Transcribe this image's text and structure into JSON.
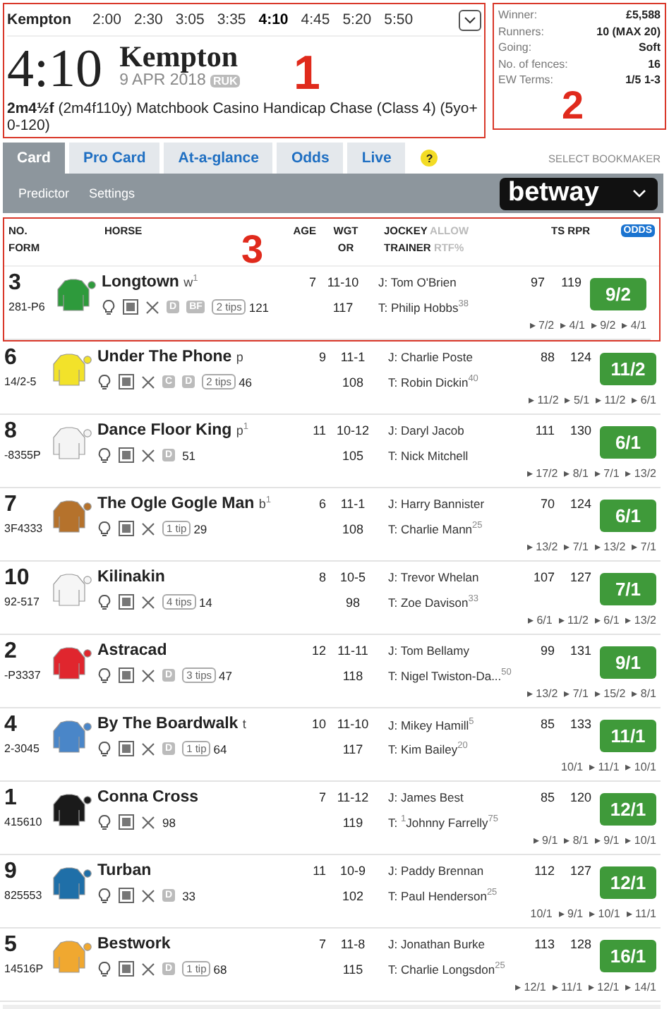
{
  "race_nav": {
    "course": "Kempton",
    "times": [
      {
        "label": "2:00",
        "selected": false
      },
      {
        "label": "2:30",
        "selected": false
      },
      {
        "label": "3:05",
        "selected": false
      },
      {
        "label": "3:35",
        "selected": false
      },
      {
        "label": "4:10",
        "selected": true
      },
      {
        "label": "4:45",
        "selected": false
      },
      {
        "label": "5:20",
        "selected": false
      },
      {
        "label": "5:50",
        "selected": false
      }
    ]
  },
  "race": {
    "time": "4:10",
    "course": "Kempton",
    "date": "9 APR 2018",
    "channel": "RUK",
    "description": "**2m4½f** (2m4f110y) Matchbook Casino Handicap Chase (Class 4) (5yo+ 0-120)",
    "callout": "1"
  },
  "race_info": {
    "rows": [
      {
        "label": "Winner:",
        "value": "£5,588"
      },
      {
        "label": "Runners:",
        "value": "10 (MAX 20)"
      },
      {
        "label": "Going:",
        "value": "Soft"
      },
      {
        "label": "No. of fences:",
        "value": "16"
      },
      {
        "label": "EW Terms:",
        "value": "1/5 1-3"
      }
    ],
    "callout": "2"
  },
  "tabs": [
    {
      "label": "Card",
      "selected": true
    },
    {
      "label": "Pro Card",
      "selected": false
    },
    {
      "label": "At-a-glance",
      "selected": false
    },
    {
      "label": "Odds",
      "selected": false
    },
    {
      "label": "Live",
      "selected": false
    }
  ],
  "help": "?",
  "select_bookmaker": "SELECT BOOKMAKER",
  "sub_links": [
    "Predictor",
    "Settings"
  ],
  "bookmaker": "betway",
  "table": {
    "callout": "3",
    "columns": {
      "no": "NO.",
      "form": "FORM",
      "horse": "HORSE",
      "age": "AGE",
      "wgt": "WGT",
      "or": "OR",
      "jockey": "JOCKEY",
      "allow": "ALLOW",
      "trainer": "TRAINER",
      "rtf": "RTF%",
      "ts_rpr": "TS RPR",
      "odds": "ODDS"
    },
    "rows": [
      {
        "no": "3",
        "form": "281-P6",
        "color": "#2e9a3c",
        "name": "Longtown",
        "headgear": "w$^{1}$",
        "badges": [
          "D",
          "BF"
        ],
        "tips": "2 tips",
        "rating": "121",
        "age": "7",
        "wgt": "11-10",
        "or": "117",
        "jockey": "J: Tom O'Brien",
        "trainer": "T: Philip Hobbs$^{38}$",
        "ts": "97",
        "rpr": "119",
        "odds": "9/2",
        "history": "▸ 7/2  ▸ 4/1  ▸ 9/2  ▸ 4/1"
      },
      {
        "no": "6",
        "form": "14/2-5",
        "color": "#f2e22a",
        "name": "Under The Phone",
        "headgear": "p",
        "badges": [
          "C",
          "D"
        ],
        "tips": "2 tips",
        "rating": "46",
        "age": "9",
        "wgt": "11-1",
        "or": "108",
        "jockey": "J: Charlie Poste",
        "trainer": "T: Robin Dickin$^{40}$",
        "ts": "88",
        "rpr": "124",
        "odds": "11/2",
        "history": "▸ 11/2  ▸ 5/1  ▸ 11/2  ▸ 6/1"
      },
      {
        "no": "8",
        "form": "-8355P",
        "color": "#f4f4f4",
        "name": "Dance Floor King",
        "headgear": "p$^{1}$",
        "badges": [
          "D"
        ],
        "rating": "51",
        "age": "11",
        "wgt": "10-12",
        "or": "105",
        "jockey": "J: Daryl Jacob",
        "trainer": "T: Nick Mitchell",
        "ts": "111",
        "rpr": "130",
        "odds": "6/1",
        "history": "▸ 17/2  ▸ 8/1  ▸ 7/1  ▸ 13/2"
      },
      {
        "no": "7",
        "form": "3F4333",
        "color": "#b5722c",
        "name": "The Ogle Gogle Man",
        "headgear": "b$^{1}$",
        "badges": [],
        "tips": "1 tip",
        "rating": "29",
        "age": "6",
        "wgt": "11-1",
        "or": "108",
        "jockey": "J: Harry Bannister",
        "trainer": "T: Charlie Mann$^{25}$",
        "ts": "70",
        "rpr": "124",
        "odds": "6/1",
        "history": "▸ 13/2  ▸ 7/1  ▸ 13/2  ▸ 7/1"
      },
      {
        "no": "10",
        "form": "92-517",
        "color": "#f6f6f6",
        "name": "Kilinakin",
        "badges": [],
        "tips": "4 tips",
        "rating": "14",
        "age": "8",
        "wgt": "10-5",
        "or": "98",
        "jockey": "J: Trevor Whelan",
        "trainer": "T: Zoe Davison$^{33}$",
        "ts": "107",
        "rpr": "127",
        "odds": "7/1",
        "history": "▸ 6/1  ▸ 11/2  ▸ 6/1  ▸ 13/2"
      },
      {
        "no": "2",
        "form": "-P3337",
        "color": "#e0262e",
        "name": "Astracad",
        "badges": [
          "D"
        ],
        "tips": "3 tips",
        "rating": "47",
        "age": "12",
        "wgt": "11-11",
        "or": "118",
        "jockey": "J: Tom Bellamy",
        "trainer": "T: Nigel Twiston-Da...$^{50}$",
        "ts": "99",
        "rpr": "131",
        "odds": "9/1",
        "history": "▸ 13/2  ▸ 7/1  ▸ 15/2  ▸ 8/1"
      },
      {
        "no": "4",
        "form": "2-3045",
        "color": "#4a86c8",
        "name": "By The Boardwalk",
        "headgear": "t",
        "badges": [
          "D"
        ],
        "tips": "1 tip",
        "rating": "64",
        "age": "10",
        "wgt": "11-10",
        "or": "117",
        "jockey": "J: Mikey Hamill$^{5}$",
        "trainer": "T: Kim Bailey$^{20}$",
        "ts": "85",
        "rpr": "133",
        "odds": "11/1",
        "history": "10/1  ▸ 11/1  ▸ 10/1"
      },
      {
        "no": "1",
        "form": "415610",
        "color": "#1a1a1a",
        "name": "Conna Cross",
        "badges": [],
        "rating": "98",
        "age": "7",
        "wgt": "11-12",
        "or": "119",
        "jockey": "J: James Best",
        "trainer": "T: $^{1}$Johnny Farrelly$^{75}$",
        "ts": "85",
        "rpr": "120",
        "odds": "12/1",
        "history": "▸ 9/1  ▸ 8/1  ▸ 9/1  ▸ 10/1"
      },
      {
        "no": "9",
        "form": "825553",
        "color": "#1f6fa8",
        "name": "Turban",
        "badges": [
          "D"
        ],
        "rating": "33",
        "age": "11",
        "wgt": "10-9",
        "or": "102",
        "jockey": "J: Paddy Brennan",
        "trainer": "T: Paul Henderson$^{25}$",
        "ts": "112",
        "rpr": "127",
        "odds": "12/1",
        "history": "10/1  ▸ 9/1  ▸ 10/1  ▸ 11/1"
      },
      {
        "no": "5",
        "form": "14516P",
        "color": "#f0a830",
        "name": "Bestwork",
        "badges": [
          "D"
        ],
        "tips": "1 tip",
        "rating": "68",
        "age": "7",
        "wgt": "11-8",
        "or": "115",
        "jockey": "J: Jonathan Burke",
        "trainer": "T: Charlie Longsdon$^{25}$",
        "ts": "113",
        "rpr": "128",
        "odds": "16/1",
        "history": "▸ 12/1  ▸ 11/1  ▸ 12/1  ▸ 14/1"
      }
    ]
  }
}
